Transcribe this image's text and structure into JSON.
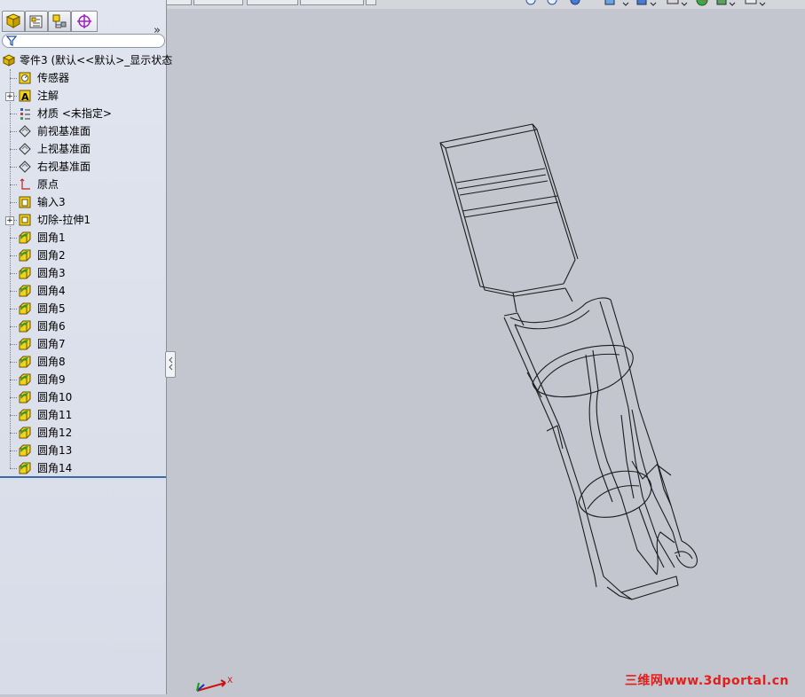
{
  "feature_tree": {
    "part_name": "零件3  (默认<<默认>_显示状态",
    "items": [
      {
        "label": "传感器",
        "icon": "sensor-icon"
      },
      {
        "label": "注解",
        "icon": "annotation-icon",
        "expandable": true
      },
      {
        "label": "材质 <未指定>",
        "icon": "material-icon"
      },
      {
        "label": "前视基准面",
        "icon": "plane-icon"
      },
      {
        "label": "上视基准面",
        "icon": "plane-icon"
      },
      {
        "label": "右视基准面",
        "icon": "plane-icon"
      },
      {
        "label": "原点",
        "icon": "origin-icon"
      },
      {
        "label": "输入3",
        "icon": "import-icon"
      },
      {
        "label": "切除-拉伸1",
        "icon": "cut-extrude-icon",
        "expandable": true
      },
      {
        "label": "圆角1",
        "icon": "fillet-icon"
      },
      {
        "label": "圆角2",
        "icon": "fillet-icon"
      },
      {
        "label": "圆角3",
        "icon": "fillet-icon"
      },
      {
        "label": "圆角4",
        "icon": "fillet-icon"
      },
      {
        "label": "圆角5",
        "icon": "fillet-icon"
      },
      {
        "label": "圆角6",
        "icon": "fillet-icon"
      },
      {
        "label": "圆角7",
        "icon": "fillet-icon"
      },
      {
        "label": "圆角8",
        "icon": "fillet-icon"
      },
      {
        "label": "圆角9",
        "icon": "fillet-icon"
      },
      {
        "label": "圆角10",
        "icon": "fillet-icon"
      },
      {
        "label": "圆角11",
        "icon": "fillet-icon"
      },
      {
        "label": "圆角12",
        "icon": "fillet-icon"
      },
      {
        "label": "圆角13",
        "icon": "fillet-icon"
      },
      {
        "label": "圆角14",
        "icon": "fillet-icon"
      }
    ]
  },
  "panel_tabs": [
    "feature-manager-tab-icon",
    "property-manager-tab-icon",
    "configuration-manager-tab-icon",
    "dimxpert-tab-icon"
  ],
  "viewport": {
    "triad_axis_label": "X",
    "watermark": "三维网www.3dportal.cn"
  },
  "colors": {
    "viewport_bg": "#c3c6cf",
    "panel_bg": "#dde1ec",
    "fillet_yellow": "#f3d31a",
    "fillet_green": "#2f9a3a",
    "watermark_red": "#e0201c"
  }
}
